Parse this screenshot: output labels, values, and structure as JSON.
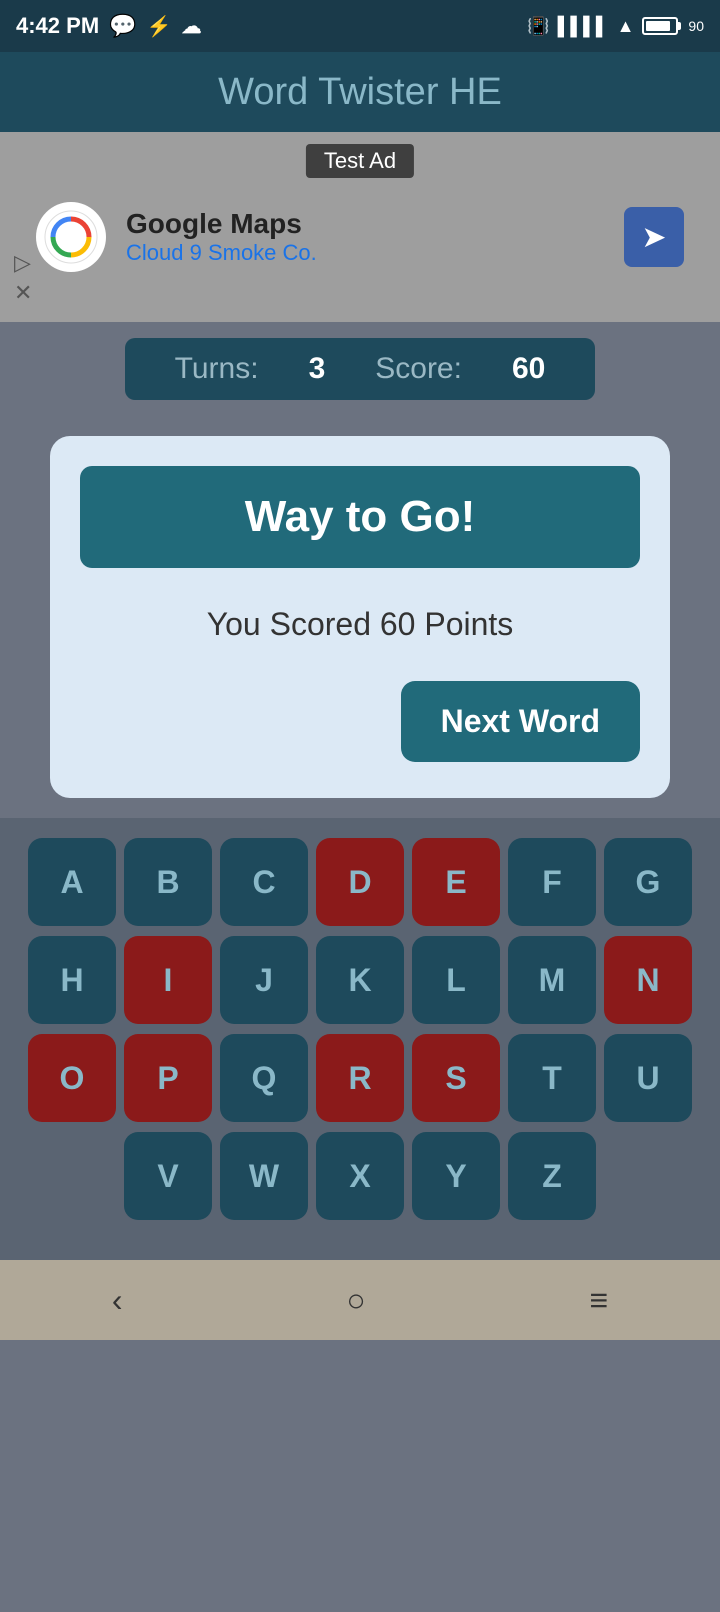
{
  "statusBar": {
    "time": "4:42 PM",
    "battery": "90"
  },
  "header": {
    "title": "Word Twister HE"
  },
  "ad": {
    "label": "Test Ad",
    "company": "Google Maps",
    "subtitle": "Cloud 9 Smoke Co."
  },
  "scoreBar": {
    "turnsLabel": "Turns:",
    "turnsValue": "3",
    "scoreLabel": "Score:",
    "scoreValue": "60"
  },
  "modal": {
    "title": "Way to Go!",
    "scoreText": "You Scored 60 Points",
    "nextWordBtn": "Next Word"
  },
  "keyboard": {
    "rows": [
      [
        "A",
        "B",
        "C",
        "D",
        "E",
        "F",
        "G"
      ],
      [
        "H",
        "I",
        "J",
        "K",
        "L",
        "M",
        "N"
      ],
      [
        "O",
        "P",
        "Q",
        "R",
        "S",
        "T",
        "U"
      ],
      [
        "V",
        "W",
        "X",
        "Y",
        "Z"
      ]
    ],
    "usedKeys": [
      "D",
      "E",
      "I",
      "N",
      "O",
      "P",
      "R",
      "S"
    ]
  },
  "nav": {
    "back": "‹",
    "home": "○",
    "menu": "≡"
  }
}
